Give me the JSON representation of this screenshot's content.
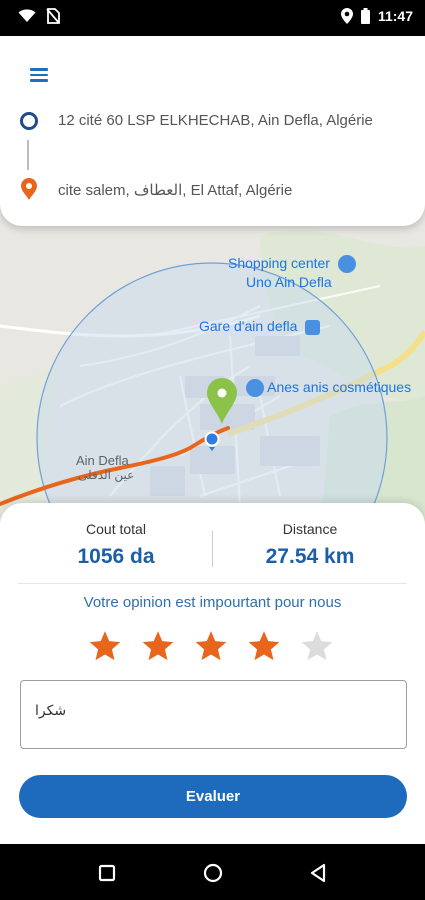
{
  "status_bar": {
    "time": "11:47",
    "icons": [
      "wifi-icon",
      "no-sim-icon",
      "location-icon",
      "battery-icon"
    ]
  },
  "map": {
    "labels": {
      "shopping_center_line1": "Shopping center",
      "shopping_center_line2": "Uno Ain Defla",
      "gare": "Gare d'ain defla",
      "anes": "Anes anis cosmétiques",
      "ain_defla": "Ain Defla",
      "ain_defla_ar": "عين الدفلى"
    },
    "colors": {
      "route": "#e8661b",
      "radius_fill": "#c5daf0",
      "pin": "#8bc34a",
      "position": "#2f7de1"
    }
  },
  "address_card": {
    "origin": "12 cité 60 LSP ELKHECHAB, Ain Defla, Algérie",
    "destination": "cite salem, العطاف, El Attaf, Algérie"
  },
  "summary": {
    "cost_label": "Cout total",
    "cost_value": "1056 da",
    "distance_label": "Distance",
    "distance_value": "27.54 km"
  },
  "rating": {
    "prompt": "Votre opinion est impourtant pour nous",
    "stars_total": 5,
    "stars_selected": 4,
    "colors": {
      "active": "#e8661b",
      "inactive": "#dcdcdc"
    }
  },
  "comment": {
    "value": "شكرا"
  },
  "submit": {
    "label": "Evaluer"
  },
  "nav": {
    "buttons": [
      "recents-icon",
      "home-icon",
      "back-icon"
    ]
  }
}
